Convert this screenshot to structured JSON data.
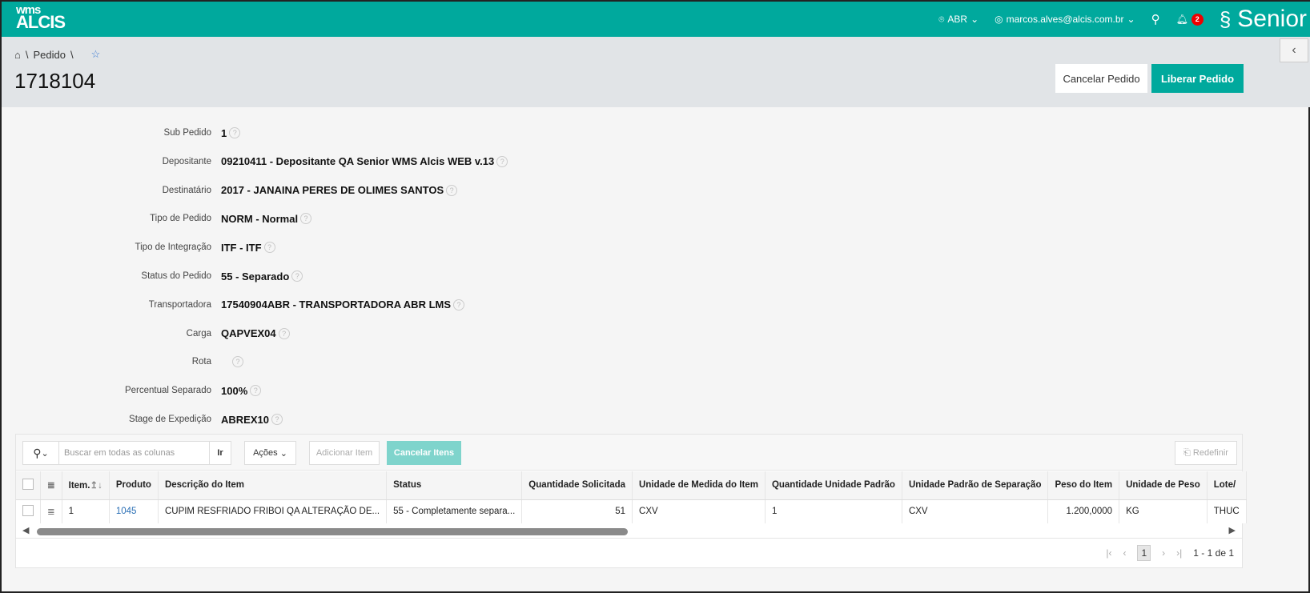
{
  "header": {
    "logo_top": "wms",
    "logo_bottom": "ALCIS",
    "region": "ABR",
    "user": "marcos.alves@alcis.com.br",
    "notifications": "2",
    "brand": "Senior",
    "accent": "#00a99d"
  },
  "breadcrumb": {
    "items": [
      "Pedido"
    ]
  },
  "page": {
    "title": "1718104",
    "cancel_label": "Cancelar Pedido",
    "release_label": "Liberar Pedido"
  },
  "form": [
    {
      "label": "Sub Pedido",
      "value": "1"
    },
    {
      "label": "Depositante",
      "value": "09210411 - Depositante QA Senior WMS Alcis WEB v.13"
    },
    {
      "label": "Destinatário",
      "value": "2017 - JANAINA PERES DE OLIMES SANTOS"
    },
    {
      "label": "Tipo de Pedido",
      "value": "NORM - Normal"
    },
    {
      "label": "Tipo de Integração",
      "value": "ITF - ITF"
    },
    {
      "label": "Status do Pedido",
      "value": "55 - Separado"
    },
    {
      "label": "Transportadora",
      "value": "17540904ABR - TRANSPORTADORA ABR LMS"
    },
    {
      "label": "Carga",
      "value": "QAPVEX04"
    },
    {
      "label": "Rota",
      "value": ""
    },
    {
      "label": "Percentual Separado",
      "value": "100%"
    },
    {
      "label": "Stage de Expedição",
      "value": "ABREX10"
    }
  ],
  "help_glyph": "?",
  "grid": {
    "search_placeholder": "Buscar em todas as colunas",
    "go_label": "Ir",
    "actions_label": "Ações",
    "add_label": "Adicionar Item",
    "cancel_items_label": "Cancelar Itens",
    "reset_label": "Redefinir",
    "columns": [
      "Item.",
      "Produto",
      "Descrição do Item",
      "Status",
      "Quantidade Solicitada",
      "Unidade de Medida do Item",
      "Quantidade Unidade Padrão",
      "Unidade Padrão de Separação",
      "Peso do Item",
      "Unidade de Peso",
      "Lote/"
    ],
    "rows": [
      [
        "1",
        "1045",
        "CUPIM RESFRIADO FRIBOI QA ALTERAÇÃO DE...",
        "55 - Completamente separa...",
        "51",
        "CXV",
        "1",
        "CXV",
        "1.200,0000",
        "KG",
        "THUC"
      ]
    ],
    "page": "1",
    "range": "1 - 1 de 1"
  }
}
